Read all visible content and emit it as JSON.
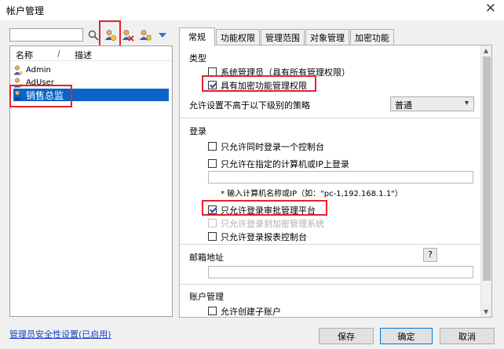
{
  "window": {
    "title": "帐户管理",
    "close_glyph": "✕"
  },
  "toolbar": {
    "search_value": "",
    "icons": [
      "search-icon",
      "add-user-icon",
      "delete-user-icon",
      "edit-user-icon",
      "dropdown-arrow-icon"
    ]
  },
  "user_list": {
    "headers": {
      "name": "名称",
      "separator": "/",
      "desc": "描述"
    },
    "rows": [
      {
        "name": "Admin"
      },
      {
        "name": "AdUser"
      },
      {
        "name": "销售总监",
        "selected": true
      }
    ]
  },
  "tabs": [
    "常规",
    "功能权限",
    "管理范围",
    "对象管理",
    "加密功能"
  ],
  "general": {
    "type_title": "类型",
    "sysadmin_label": "系统管理员（具有所有管理权限）",
    "encrypt_label": "具有加密功能管理权限",
    "policy_label": "允许设置不高于以下级别的策略",
    "policy_value": "普通",
    "login_title": "登录",
    "login_opt1": "只允许同时登录一个控制台",
    "login_opt2": "只允许在指定的计算机或IP上登录",
    "ip_value": "",
    "ip_hint": "* 输入计算机名称或IP（如：\"pc-1,192.168.1.1\"）",
    "login_opt3": "只允许登录审批管理平台",
    "login_opt4": "只允许登录到加密管理系统",
    "login_opt5": "只允许登录报表控制台",
    "email_title": "邮箱地址",
    "help_label": "?",
    "email_value": "",
    "account_title": "账户管理",
    "account_opt1": "允许创建子账户"
  },
  "footer": {
    "security_link": "管理员安全性设置(已启用)",
    "save": "保存",
    "ok": "确定",
    "cancel": "取消"
  },
  "colors": {
    "selection": "#0a64c8",
    "highlight": "#e8202a",
    "link": "#1a3ec8"
  }
}
